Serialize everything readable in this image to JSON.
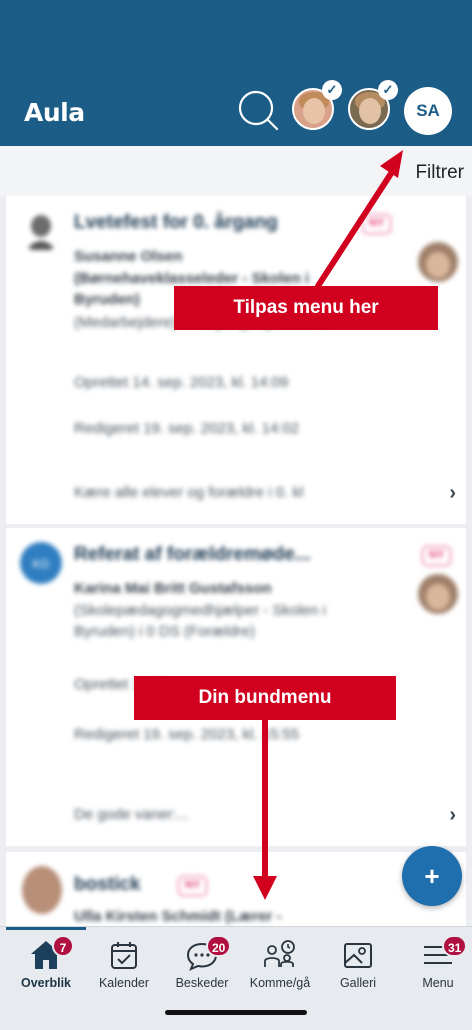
{
  "header": {
    "app_title": "Aula",
    "profile_initials": "SA",
    "colors": {
      "bar": "#1c5d88"
    }
  },
  "filter": {
    "label": "Filtrer"
  },
  "posts": [
    {
      "title": "Lvetefest for 0. årgang",
      "badge": "NY",
      "author": "Susanne Olsen",
      "role": "(Børnehaveklasseleder - Skolen i Byruden)",
      "recipients": "(Medarbejdere) i 0 årgang, 1g 2 andre",
      "created": "Oprettet 14. sep. 2023, kl. 14:09",
      "edited": "Redigeret 19. sep. 2023, kl. 14:02",
      "preview": "Kære alle elever og forældre i 0. kl"
    },
    {
      "title": "Referat af forældremøde...",
      "badge": "NY",
      "author": "Karina Mai Britt Gustafsson",
      "role": "(Skolepædagogmedhjælper - Skolen i Byruden) i 0 DS (Forældre)",
      "created": "Oprettet 18:52",
      "edited": "Redigeret 19. sep. 2023, kl. 15:55",
      "preview": "De gode vaner:..."
    },
    {
      "title": "bostick",
      "badge": "NY",
      "author": "Ulla Kirsten Schmidt (Lærer -"
    }
  ],
  "annotations": {
    "top_callout": "Tilpas menu her",
    "bottom_callout": "Din bundmenu",
    "color": "#d1001e"
  },
  "fab": {
    "symbol": "+"
  },
  "bottom_nav": {
    "items": [
      {
        "label": "Overblik",
        "icon": "home-icon",
        "badge": "7",
        "active": true
      },
      {
        "label": "Kalender",
        "icon": "calendar-icon",
        "badge": ""
      },
      {
        "label": "Beskeder",
        "icon": "chat-bubble-icon",
        "badge": "20"
      },
      {
        "label": "Komme/gå",
        "icon": "people-clock-icon",
        "badge": ""
      },
      {
        "label": "Galleri",
        "icon": "image-icon",
        "badge": ""
      },
      {
        "label": "Menu",
        "icon": "hamburger-icon",
        "badge": "31"
      }
    ]
  }
}
